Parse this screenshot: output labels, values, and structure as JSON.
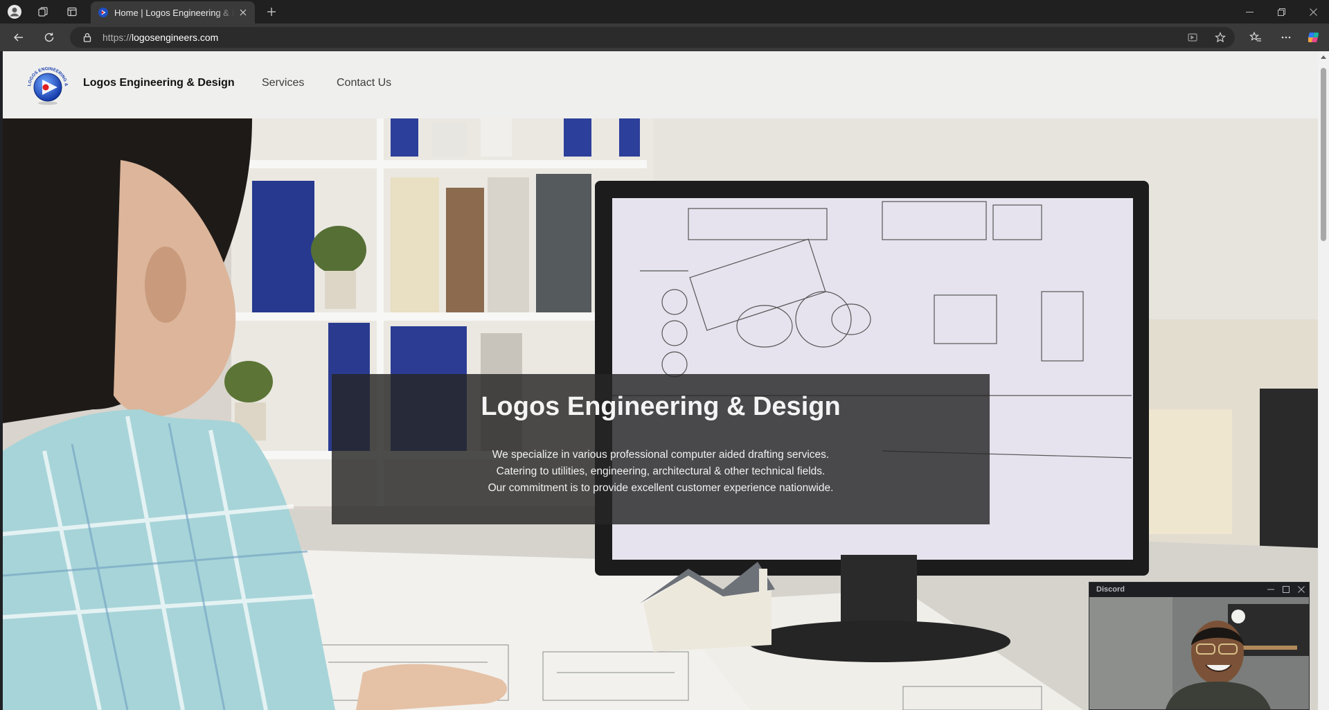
{
  "browser": {
    "tab": {
      "title": "Home | Logos Engineering & Design"
    },
    "address_bar": {
      "protocol": "https://",
      "host": "logosengineers.com"
    }
  },
  "icons": {
    "profile": "profile-icon",
    "workspaces": "workspaces-icon",
    "vertical_tabs": "tab-actions-icon",
    "close": "close-icon",
    "new_tab": "plus-icon",
    "back": "arrow-left-icon",
    "refresh": "refresh-icon",
    "lock": "lock-icon",
    "read_aloud": "read-aloud-icon",
    "favorite": "star-icon",
    "favorites": "favorites-icon",
    "more": "more-icon",
    "copilot": "copilot-icon"
  },
  "site": {
    "header": {
      "brand": "Logos Engineering & Design",
      "logo_text": "LOGOS ENGINEERING & DESIGN",
      "nav": [
        "Services",
        "Contact Us"
      ]
    },
    "hero": {
      "title": "Logos Engineering & Design",
      "lines": [
        "We specialize in various professional computer aided drafting services.",
        "Catering to utilities, engineering, architectural & other technical fields.",
        "Our commitment is to provide excellent customer experience nationwide."
      ]
    }
  },
  "discord_window": {
    "title": "Discord"
  },
  "colors": {
    "chrome_dark": "#202020",
    "chrome_toolbar": "#3a3a3a",
    "header_bg": "#efefed",
    "hero_overlay": "#262626",
    "logo_blue": "#1e4fc4",
    "logo_red": "#e02020"
  }
}
